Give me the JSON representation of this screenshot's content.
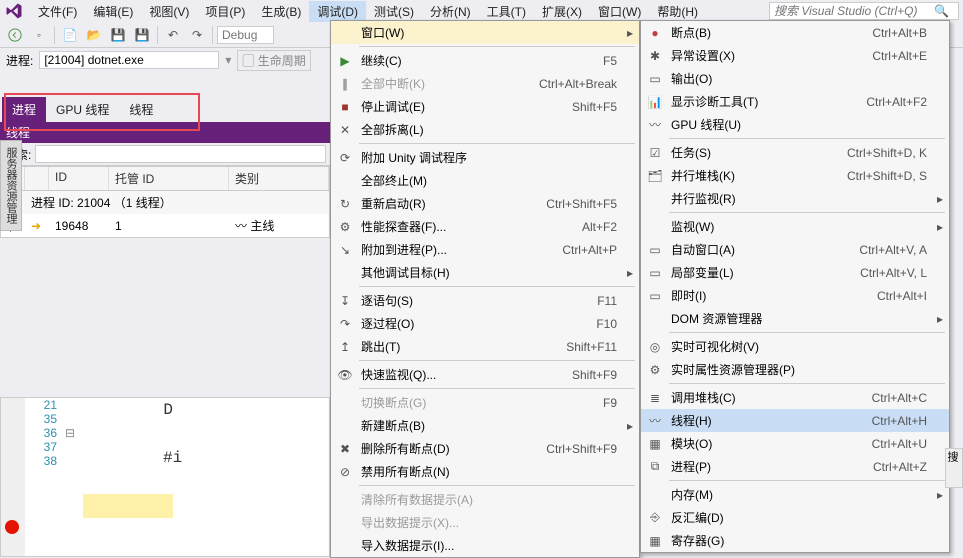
{
  "menubar": {
    "items": [
      "文件(F)",
      "编辑(E)",
      "视图(V)",
      "项目(P)",
      "生成(B)",
      "调试(D)",
      "测试(S)",
      "分析(N)",
      "工具(T)",
      "扩展(X)",
      "窗口(W)",
      "帮助(H)"
    ],
    "search_placeholder": "搜索 Visual Studio (Ctrl+Q)"
  },
  "toolbar": {
    "debug_label": "Debug"
  },
  "process_bar": {
    "label": "进程:",
    "value": "[21004] dotnet.exe",
    "lifecycle": "生命周期"
  },
  "tabs": {
    "items": [
      "进程",
      "GPU 线程",
      "线程"
    ],
    "sub": "线程",
    "search_label": "搜索:"
  },
  "grid": {
    "headers": {
      "id": "ID",
      "mid": "托管 ID",
      "cat": "类别"
    },
    "group": "进程 ID: 21004 （1 线程）",
    "row": {
      "id": "19648",
      "mid": "1",
      "cat": "主线"
    }
  },
  "editor": {
    "lines": [
      "21",
      "35",
      "36",
      "37",
      "38"
    ],
    "token": "D",
    "hash": "#i"
  },
  "menu1": [
    {
      "icon": "",
      "text": "窗口(W)",
      "key": "",
      "arrow": true,
      "hl": "top"
    },
    {
      "sep": true
    },
    {
      "icon": "▶",
      "text": "继续(C)",
      "key": "F5",
      "color": "#388a34"
    },
    {
      "icon": "∥",
      "text": "全部中断(K)",
      "key": "Ctrl+Alt+Break",
      "disabled": true
    },
    {
      "icon": "■",
      "text": "停止调试(E)",
      "key": "Shift+F5",
      "color": "#a03434"
    },
    {
      "icon": "✕",
      "text": "全部拆离(L)",
      "key": ""
    },
    {
      "sep": true
    },
    {
      "icon": "⟳",
      "text": "附加 Unity 调试程序",
      "key": ""
    },
    {
      "icon": "",
      "text": "全部终止(M)",
      "key": ""
    },
    {
      "icon": "↻",
      "text": "重新启动(R)",
      "key": "Ctrl+Shift+F5"
    },
    {
      "icon": "⚙",
      "text": "性能探查器(F)...",
      "key": "Alt+F2"
    },
    {
      "icon": "↘",
      "text": "附加到进程(P)...",
      "key": "Ctrl+Alt+P"
    },
    {
      "icon": "",
      "text": "其他调试目标(H)",
      "key": "",
      "arrow": true
    },
    {
      "sep": true
    },
    {
      "icon": "↧",
      "text": "逐语句(S)",
      "key": "F11"
    },
    {
      "icon": "↷",
      "text": "逐过程(O)",
      "key": "F10"
    },
    {
      "icon": "↥",
      "text": "跳出(T)",
      "key": "Shift+F11"
    },
    {
      "sep": true
    },
    {
      "icon": "👁",
      "text": "快速监视(Q)...",
      "key": "Shift+F9"
    },
    {
      "sep": true
    },
    {
      "icon": "",
      "text": "切换断点(G)",
      "key": "F9",
      "disabled": true
    },
    {
      "icon": "",
      "text": "新建断点(B)",
      "key": "",
      "arrow": true
    },
    {
      "icon": "✖",
      "text": "删除所有断点(D)",
      "key": "Ctrl+Shift+F9"
    },
    {
      "icon": "⊘",
      "text": "禁用所有断点(N)",
      "key": ""
    },
    {
      "sep": true
    },
    {
      "icon": "",
      "text": "清除所有数据提示(A)",
      "key": "",
      "disabled": true
    },
    {
      "icon": "",
      "text": "导出数据提示(X)...",
      "key": "",
      "disabled": true
    },
    {
      "icon": "",
      "text": "导入数据提示(I)...",
      "key": ""
    }
  ],
  "menu2": [
    {
      "icon": "●",
      "text": "断点(B)",
      "key": "Ctrl+Alt+B",
      "color": "#c04040"
    },
    {
      "icon": "✱",
      "text": "异常设置(X)",
      "key": "Ctrl+Alt+E"
    },
    {
      "icon": "▭",
      "text": "输出(O)",
      "key": ""
    },
    {
      "icon": "📊",
      "text": "显示诊断工具(T)",
      "key": "Ctrl+Alt+F2"
    },
    {
      "icon": "〰",
      "text": "GPU 线程(U)",
      "key": ""
    },
    {
      "sep": true
    },
    {
      "icon": "☑",
      "text": "任务(S)",
      "key": "Ctrl+Shift+D, K"
    },
    {
      "icon": "🗂",
      "text": "并行堆栈(K)",
      "key": "Ctrl+Shift+D, S"
    },
    {
      "icon": "",
      "text": "并行监视(R)",
      "key": "",
      "arrow": true
    },
    {
      "sep": true
    },
    {
      "icon": "",
      "text": "监视(W)",
      "key": "",
      "arrow": true
    },
    {
      "icon": "▭",
      "text": "自动窗口(A)",
      "key": "Ctrl+Alt+V, A"
    },
    {
      "icon": "▭",
      "text": "局部变量(L)",
      "key": "Ctrl+Alt+V, L"
    },
    {
      "icon": "▭",
      "text": "即时(I)",
      "key": "Ctrl+Alt+I"
    },
    {
      "icon": "",
      "text": "DOM 资源管理器",
      "key": "",
      "arrow": true
    },
    {
      "sep": true
    },
    {
      "icon": "◎",
      "text": "实时可视化树(V)",
      "key": ""
    },
    {
      "icon": "⚙",
      "text": "实时属性资源管理器(P)",
      "key": ""
    },
    {
      "sep": true
    },
    {
      "icon": "≣",
      "text": "调用堆栈(C)",
      "key": "Ctrl+Alt+C"
    },
    {
      "icon": "〰",
      "text": "线程(H)",
      "key": "Ctrl+Alt+H",
      "hl": true
    },
    {
      "icon": "▦",
      "text": "模块(O)",
      "key": "Ctrl+Alt+U"
    },
    {
      "icon": "⧉",
      "text": "进程(P)",
      "key": "Ctrl+Alt+Z"
    },
    {
      "sep": true
    },
    {
      "icon": "",
      "text": "内存(M)",
      "key": "",
      "arrow": true
    },
    {
      "icon": "⎆",
      "text": "反汇编(D)",
      "key": ""
    },
    {
      "icon": "▦",
      "text": "寄存器(G)",
      "key": ""
    }
  ]
}
